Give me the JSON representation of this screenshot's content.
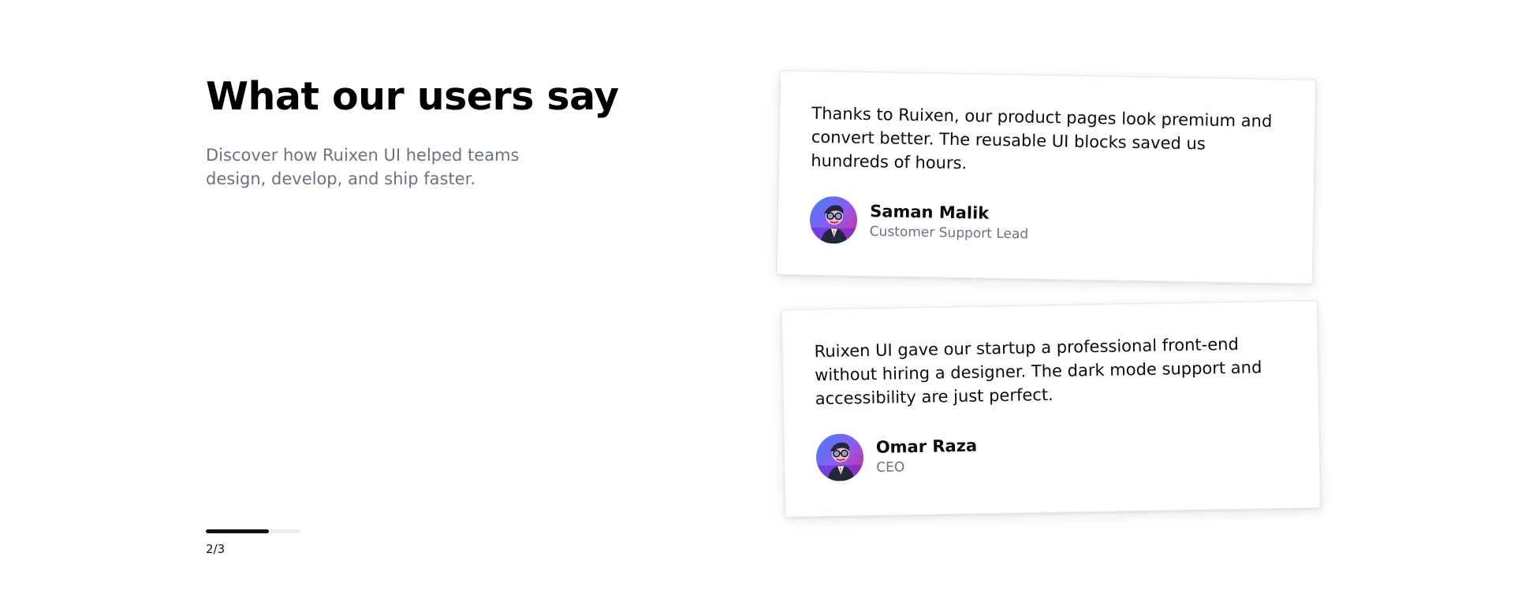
{
  "section": {
    "heading": "What our users say",
    "subheading": "Discover how Ruixen UI helped teams design, develop, and ship faster."
  },
  "pagination": {
    "label": "2/3",
    "progress_fraction": 0.67
  },
  "testimonials": [
    {
      "quote": "Thanks to Ruixen, our product pages look premium and convert better. The reusable UI blocks saved us hundreds of hours.",
      "name": "Saman Malik",
      "role": "Customer Support Lead",
      "avatar_icon": "avatar-illustration-icon"
    },
    {
      "quote": "Ruixen UI gave our startup a professional front-end without hiring a designer. The dark mode support and accessibility are just perfect.",
      "name": "Omar Raza",
      "role": "CEO",
      "avatar_icon": "avatar-illustration-icon"
    }
  ],
  "colors": {
    "heading": "#000000",
    "muted_text": "#6b7280",
    "progress_fill": "#111111",
    "progress_track": "#ececec"
  }
}
